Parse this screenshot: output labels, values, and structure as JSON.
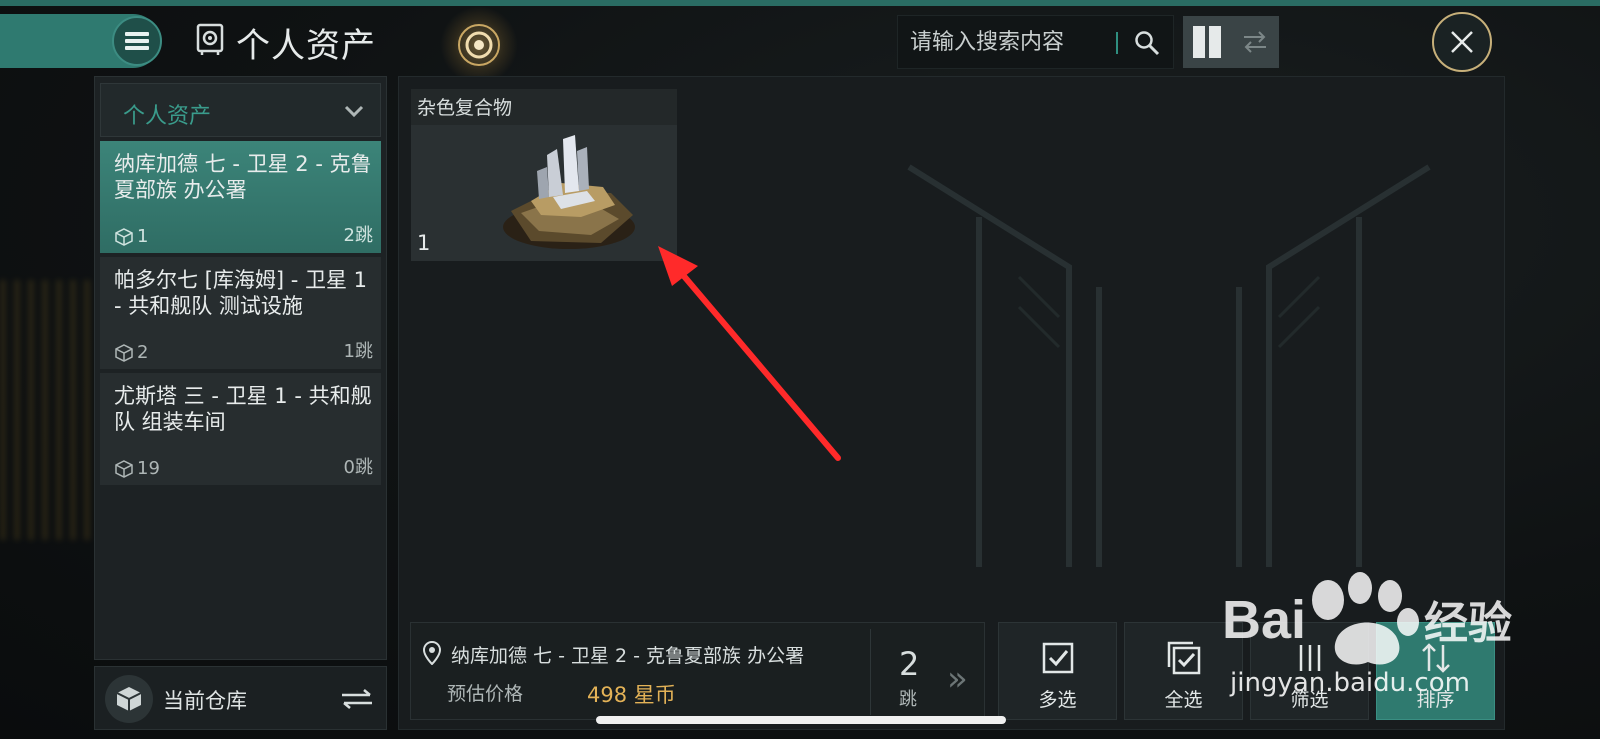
{
  "header": {
    "title": "个人资产",
    "search_placeholder": "请输入搜索内容",
    "menu_icon": "hamburger-icon",
    "close_icon": "close-icon"
  },
  "sidebar": {
    "dropdown_label": "个人资产",
    "locations": [
      {
        "name": "纳库加德 七 - 卫星 2 - 克鲁夏部族 办公署",
        "count": "1",
        "jumps": "2跳",
        "active": true
      },
      {
        "name": "帕多尔七 [库海姆] - 卫星 1 - 共和舰队 测试设施",
        "count": "2",
        "jumps": "1跳",
        "active": false
      },
      {
        "name": "尤斯塔 三 - 卫星 1 - 共和舰队 组装车间",
        "count": "19",
        "jumps": "0跳",
        "active": false
      }
    ],
    "warehouse_label": "当前仓库"
  },
  "items": [
    {
      "name": "杂色复合物",
      "quantity": "1",
      "icon": "mineral-ore-image"
    }
  ],
  "footer": {
    "location": "纳库加德 七 - 卫星 2 - 克鲁夏部族 办公署",
    "price_label": "预估价格",
    "price_value": "498 星币",
    "jumps_number": "2",
    "jumps_unit": "跳",
    "actions": [
      {
        "label": "多选",
        "icon": "multi-select-icon"
      },
      {
        "label": "全选",
        "icon": "select-all-icon"
      },
      {
        "label": "筛选",
        "icon": "filter-icon"
      },
      {
        "label": "排序",
        "icon": "sort-icon"
      }
    ]
  },
  "watermark": {
    "text": "jingyan.baidu.com"
  },
  "colors": {
    "accent": "#2f7a6f",
    "price": "#e3b257",
    "arrow": "#ff2a2a"
  }
}
